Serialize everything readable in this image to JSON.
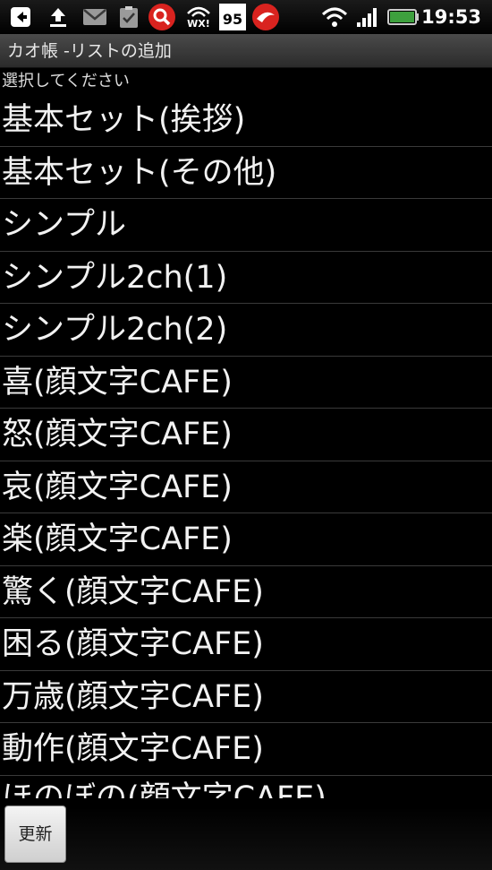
{
  "status_bar": {
    "time": "19:53",
    "badge_number": "95",
    "weather_label": "WX!",
    "icons": [
      "back-notification-icon",
      "upload-icon",
      "gmail-icon",
      "clipboard-check-icon",
      "search-app-icon",
      "weather-wifi-icon",
      "calendar-badge-icon",
      "trend-micro-icon",
      "wifi-icon",
      "signal-icon",
      "battery-icon"
    ],
    "accent": "#3ea03e"
  },
  "titlebar": {
    "title": "カオ帳 -リストの追加"
  },
  "prompt": "選択してください",
  "list": {
    "items": [
      "基本セット(挨拶)",
      "基本セット(その他)",
      "シンプル",
      "シンプル2ch(1)",
      "シンプル2ch(2)",
      "喜(顔文字CAFE)",
      "怒(顔文字CAFE)",
      "哀(顔文字CAFE)",
      "楽(顔文字CAFE)",
      "驚く(顔文字CAFE)",
      "困る(顔文字CAFE)",
      "万歳(顔文字CAFE)",
      "動作(顔文字CAFE)",
      "ほのぼの(顔文字CAFE)"
    ]
  },
  "bottom": {
    "refresh_label": "更新"
  }
}
